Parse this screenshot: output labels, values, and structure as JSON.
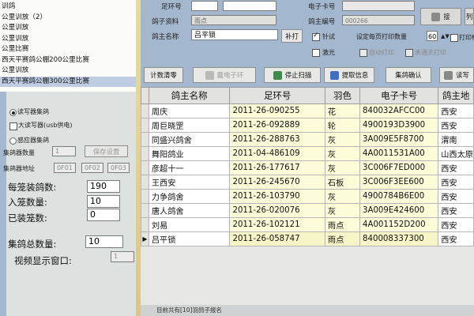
{
  "race_list": {
    "items": [
      "训鸽",
      "公里训放（2）",
      "公里训放",
      "公里训放",
      "公里比赛",
      "西天平赛鸽公棚200公里比赛",
      "公里训放",
      "西天平赛鸽公棚300公里比赛"
    ],
    "selected_index": 7
  },
  "left_panel": {
    "reader_label": "读写器集鸽",
    "usb_label": "大读写器(usb供电)",
    "induct_label": "感应器集鸽",
    "collector_count_label": "集鸽器数量",
    "collector_count_value": "1",
    "save_settings_label": "保存设置",
    "collector_addr_label": "集鸽器地址",
    "addr_values": [
      "0F01",
      "0F02",
      "0F03"
    ],
    "per_cage_label": "每笼装鸽数:",
    "per_cage_value": "190",
    "cage_in_label": "入笼数量:",
    "cage_in_value": "10",
    "loaded_label": "已装笼数:",
    "loaded_value": "0",
    "total_label": "集鸽总数量:",
    "total_value": "10",
    "video_label": "视频显示窗口:",
    "video_value": "1"
  },
  "header": {
    "ring_label": "足环号",
    "ring_value": "",
    "chip_label": "电子卡号",
    "chip_value": "",
    "owner_info_label": "鸽子资料",
    "owner_info_value": "雨点",
    "owner_no_label": "鸽主编号",
    "owner_no_value": "000266",
    "owner_name_label": "鸽主名称",
    "owner_name_value": "吕平锁",
    "print_button": "补打",
    "print_test_label": "针试",
    "print_test_checked": true,
    "per_page_label": "设定每页打印数量",
    "per_page_value": "60",
    "print_label_text": "打印标",
    "laser_label": "激光",
    "auto_print_label": "自动打印",
    "unregistered_label": "未通天打印",
    "receive_button": "接",
    "list_button": "列"
  },
  "toolbar": {
    "clear_button": "计数清零",
    "wear_chip_button": "戴电子环",
    "stop_scan_button": "停止扫描",
    "fetch_info_button": "提取信息",
    "confirm_button": "集鸽确认",
    "read_button": "读写"
  },
  "grid": {
    "columns": [
      "鸽主名称",
      "足环号",
      "羽色",
      "电子卡号",
      "鸽主地"
    ],
    "rows": [
      [
        "周庆",
        "2011-26-090255",
        "花",
        "840032AFCC00",
        "西安"
      ],
      [
        "周巨晓罡",
        "2011-26-092889",
        "轮",
        "4900193D3900",
        "西安"
      ],
      [
        "同盛兴鸽舍",
        "2011-26-288763",
        "灰",
        "3A009E5F8700",
        "渭南"
      ],
      [
        "舞阳鸽业",
        "2011-04-486109",
        "灰",
        "4A0011531A00",
        "山西太原"
      ],
      [
        "彦超十一",
        "2011-26-177617",
        "灰",
        "3C006F7ED000",
        "西安"
      ],
      [
        "王西安",
        "2011-26-245670",
        "石板",
        "3C006F3EE600",
        "西安"
      ],
      [
        "力争鸽舍",
        "2011-26-103790",
        "灰",
        "4900784B6E00",
        "西安"
      ],
      [
        "唐人鸽舍",
        "2011-26-020076",
        "灰",
        "3A009E424600",
        "西安"
      ],
      [
        "刘易",
        "2011-26-102121",
        "雨点",
        "4A001152D200",
        "西安"
      ],
      [
        "吕平锁",
        "2011-26-058747",
        "雨点",
        "840008337300",
        "西安"
      ]
    ],
    "selected_index": 9
  },
  "status": {
    "text": "目前共有[10]羽鸽子报名"
  }
}
